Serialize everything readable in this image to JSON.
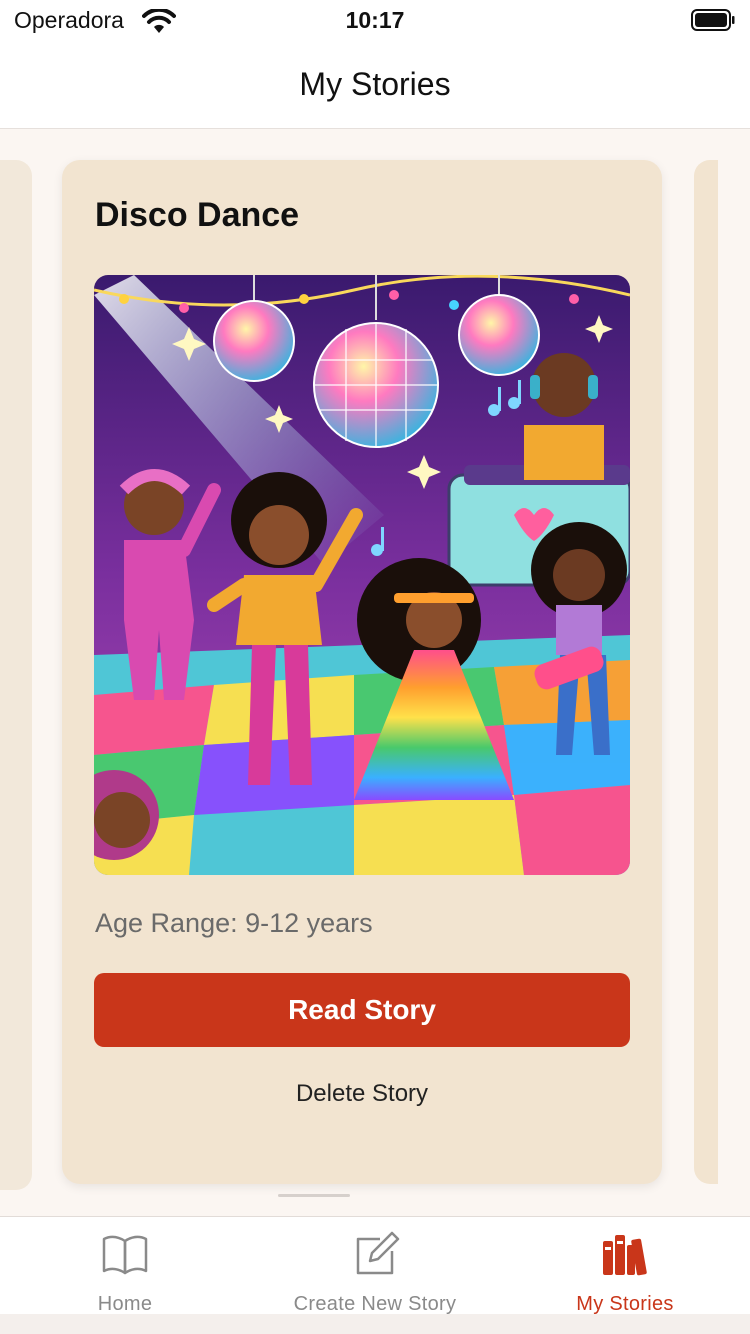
{
  "status_bar": {
    "carrier": "Operadora",
    "time": "10:17"
  },
  "nav": {
    "title": "My Stories"
  },
  "story": {
    "title": "Disco Dance",
    "age_range": "Age Range: 9-12 years",
    "read_label": "Read Story",
    "delete_label": "Delete Story",
    "image_icon": "disco-party-illustration"
  },
  "tabs": [
    {
      "label": "Home",
      "icon": "book-open-icon",
      "active": false
    },
    {
      "label": "Create New Story",
      "icon": "edit-square-icon",
      "active": false
    },
    {
      "label": "My Stories",
      "icon": "library-books-icon",
      "active": true
    }
  ],
  "colors": {
    "accent": "#c9361a",
    "card_bg": "#f2e4d0",
    "page_bg": "#fbf6f2"
  }
}
